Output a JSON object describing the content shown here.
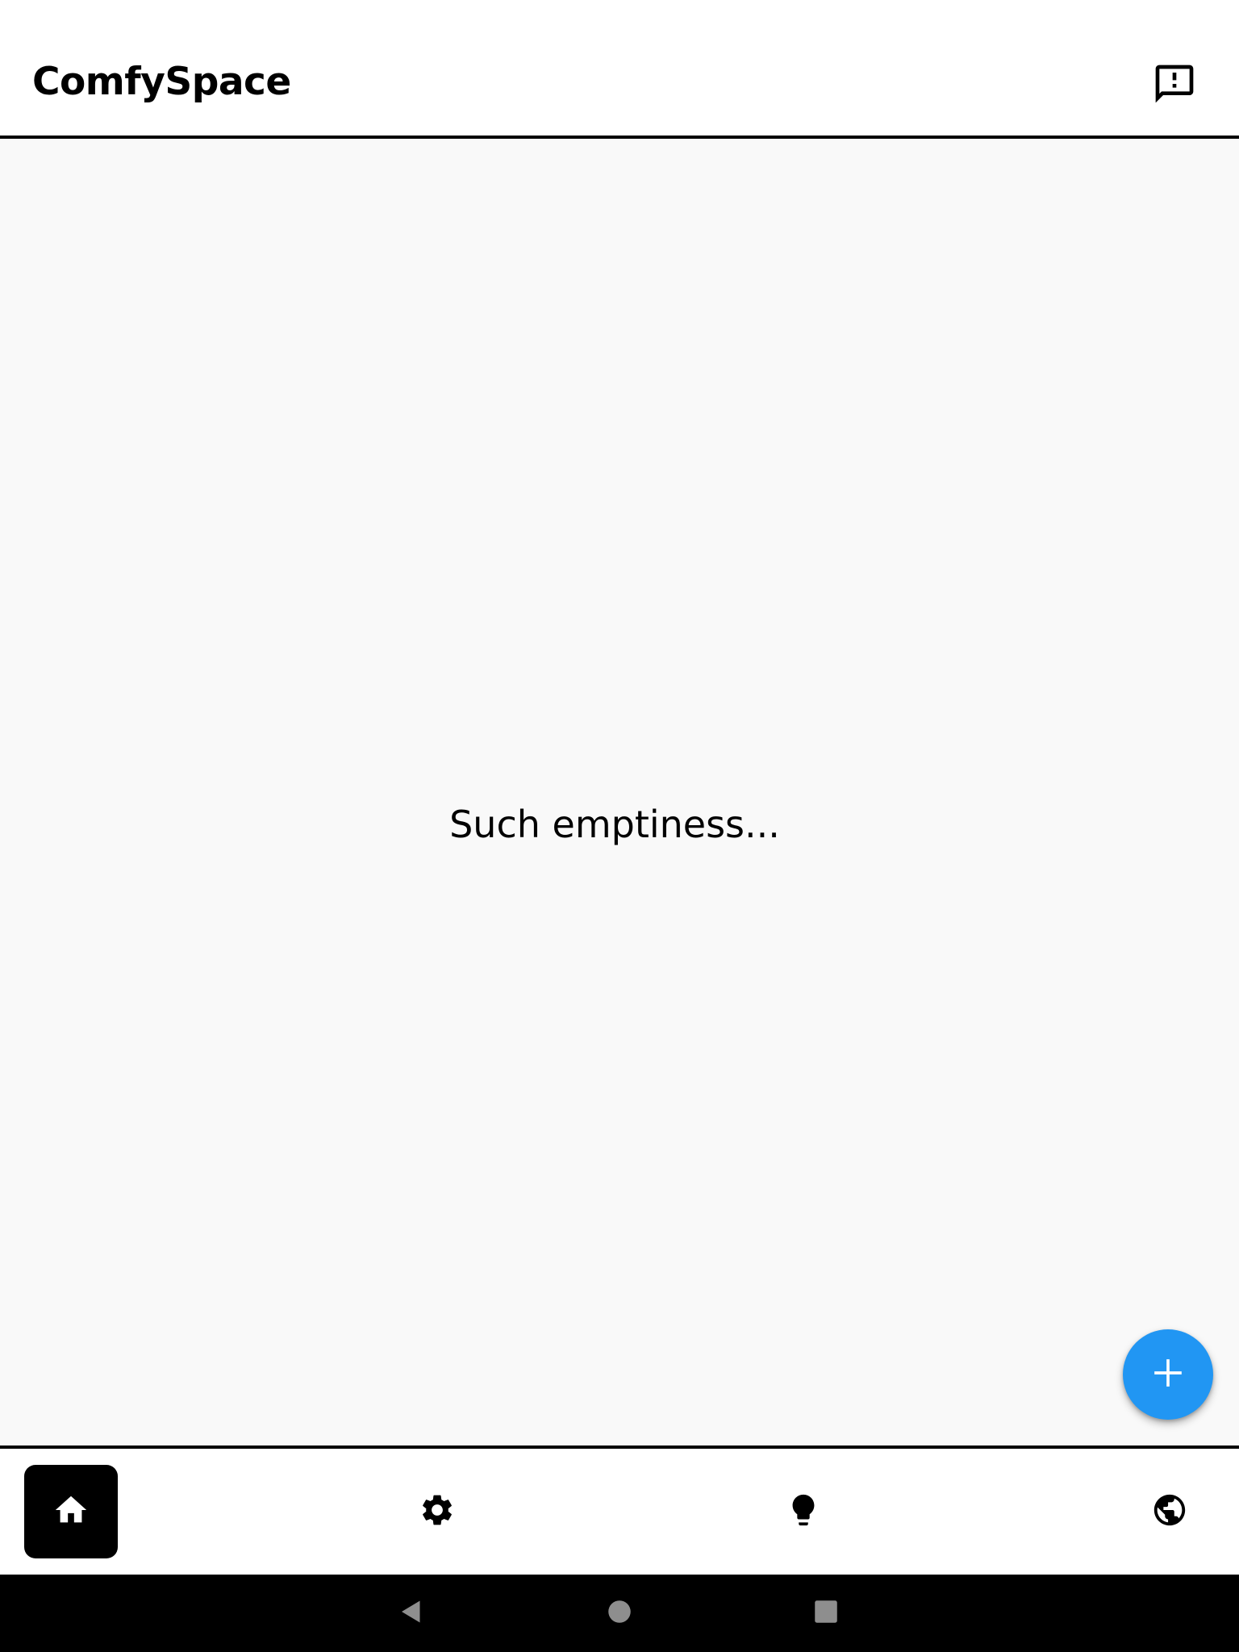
{
  "appbar": {
    "title": "ComfySpace",
    "feedback_icon": "feedback-icon"
  },
  "main": {
    "empty_message": "Such emptiness...",
    "fab_icon": "add-icon",
    "fab_color": "#2196f3"
  },
  "bottom_nav": {
    "items": [
      {
        "icon": "home-icon",
        "selected": true
      },
      {
        "icon": "settings-icon",
        "selected": false
      },
      {
        "icon": "lightbulb-icon",
        "selected": false
      },
      {
        "icon": "globe-icon",
        "selected": false
      }
    ],
    "active_color": "#000000"
  },
  "system_nav": {
    "buttons": [
      "back-icon",
      "home-circle-icon",
      "recents-icon"
    ]
  }
}
